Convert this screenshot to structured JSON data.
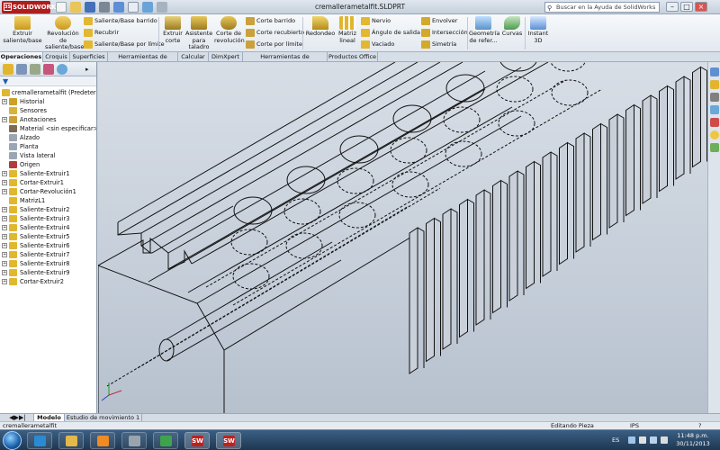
{
  "window": {
    "app_name": "SOLIDWORKS",
    "document_title": "cremallerametalfit.SLDPRT",
    "help_search_placeholder": "Buscar en la Ayuda de SolidWorks",
    "controls": [
      "–",
      "□",
      "×"
    ]
  },
  "ribbon": {
    "extruir_saliente": "Extruir saliente/base",
    "revolucion_saliente": "Revolución de saliente/base",
    "saliente_barrido": "Saliente/Base barrido",
    "recubrir": "Recubrir",
    "saliente_limite": "Saliente/Base por límite",
    "extruir_corte": "Extruir corte",
    "asistente_taladro": "Asistente para taladro",
    "corte_revolucion": "Corte de revolución",
    "corte_barrido": "Corte barrido",
    "corte_recubierto": "Corte recubierto",
    "corte_limite": "Corte por límite",
    "redondeo": "Redondeo",
    "matriz_lineal": "Matriz lineal",
    "nervio": "Nervio",
    "angulo_salida": "Ángulo de salida",
    "vaciado": "Vaciado",
    "envolver": "Envolver",
    "interseccion": "Intersección",
    "simetria": "Simetría",
    "geometria_ref": "Geometría de refer...",
    "curvas": "Curvas",
    "instant3d": "Instant 3D"
  },
  "command_tabs": [
    "Operaciones",
    "Croquis",
    "Superficies",
    "Herramientas de moldes",
    "Calcular",
    "DimXpert",
    "Herramientas de renderizado",
    "Productos Office"
  ],
  "feature_tree": {
    "root": "cremallerametalfit  (Predetermin",
    "items": [
      {
        "label": "Historial",
        "expand": "+",
        "color": "#c9a227"
      },
      {
        "label": "Sensores",
        "expand": "",
        "color": "#d6b33a"
      },
      {
        "label": "Anotaciones",
        "expand": "+",
        "color": "#caa03a"
      },
      {
        "label": "Material <sin especificar>",
        "expand": "",
        "color": "#7d6a55"
      },
      {
        "label": "Alzado",
        "expand": "",
        "color": "#9aa6b3"
      },
      {
        "label": "Planta",
        "expand": "",
        "color": "#9aa6b3"
      },
      {
        "label": "Vista lateral",
        "expand": "",
        "color": "#9aa6b3"
      },
      {
        "label": "Origen",
        "expand": "",
        "color": "#b33a3a"
      },
      {
        "label": "Saliente-Extruir1",
        "expand": "+",
        "color": "#e0b830"
      },
      {
        "label": "Cortar-Extruir1",
        "expand": "+",
        "color": "#e0b830"
      },
      {
        "label": "Cortar-Revolución1",
        "expand": "+",
        "color": "#e0b830"
      },
      {
        "label": "MatrizL1",
        "expand": "",
        "color": "#e0b830"
      },
      {
        "label": "Saliente-Extruir2",
        "expand": "+",
        "color": "#e0b830"
      },
      {
        "label": "Saliente-Extruir3",
        "expand": "+",
        "color": "#e0b830"
      },
      {
        "label": "Saliente-Extruir4",
        "expand": "+",
        "color": "#e0b830"
      },
      {
        "label": "Saliente-Extruir5",
        "expand": "+",
        "color": "#e0b830"
      },
      {
        "label": "Saliente-Extruir6",
        "expand": "+",
        "color": "#e0b830"
      },
      {
        "label": "Saliente-Extruir7",
        "expand": "+",
        "color": "#e0b830"
      },
      {
        "label": "Saliente-Extruir8",
        "expand": "+",
        "color": "#e0b830"
      },
      {
        "label": "Saliente-Extruir9",
        "expand": "+",
        "color": "#e0b830"
      },
      {
        "label": "Cortar-Extruir2",
        "expand": "+",
        "color": "#e0b830"
      }
    ]
  },
  "doc_tabs": [
    "Modelo",
    "Estudio de movimiento 1"
  ],
  "status": {
    "file": "cremallerametalfit",
    "mode": "Editando Pieza",
    "units": "IPS",
    "help": "?"
  },
  "taskbar": {
    "lang": "ES",
    "time": "11:48 p.m.",
    "date": "30/11/2013",
    "apps": [
      {
        "name": "internet-explorer",
        "color": "#2a8ad4"
      },
      {
        "name": "file-explorer",
        "color": "#e5b84a"
      },
      {
        "name": "media-player",
        "color": "#f08a24"
      },
      {
        "name": "app-gray",
        "color": "#9aa4ae"
      },
      {
        "name": "chrome",
        "color": "#3fa34d"
      },
      {
        "name": "solidworks-1",
        "label": "SW"
      },
      {
        "name": "solidworks-2",
        "label": "SW"
      }
    ]
  }
}
